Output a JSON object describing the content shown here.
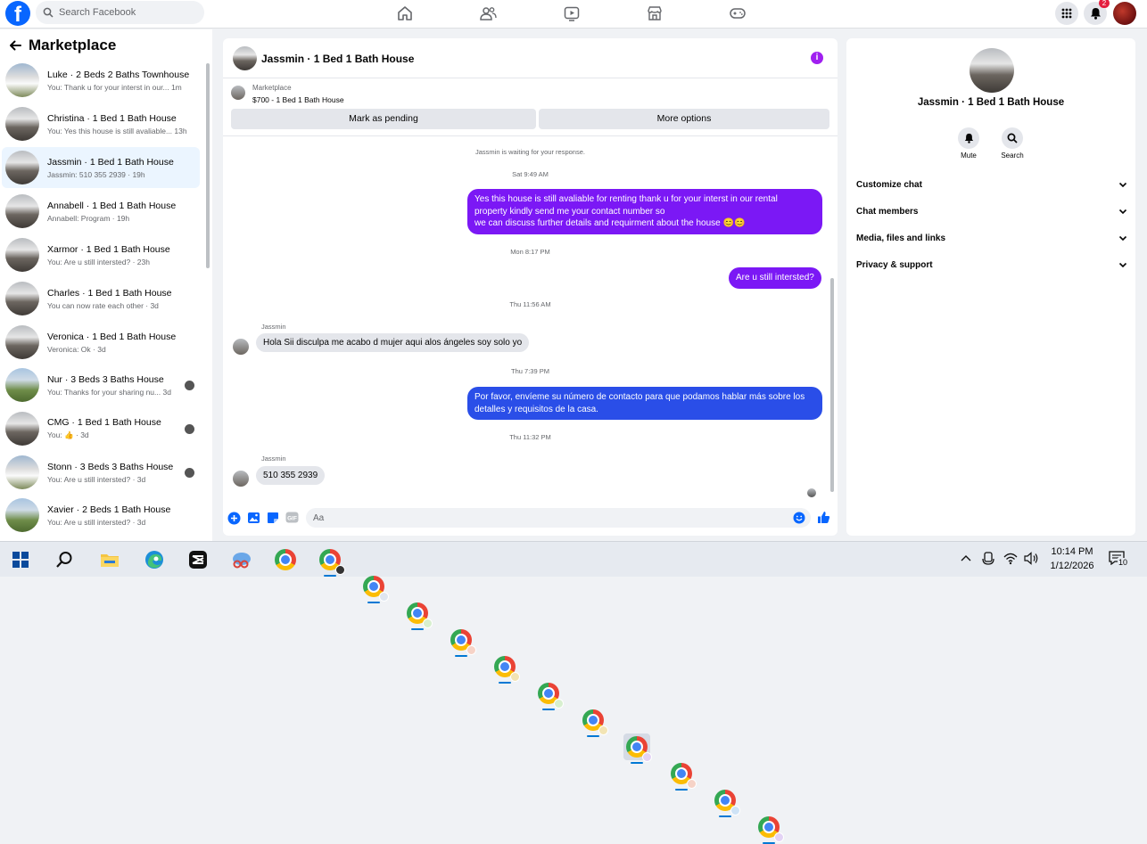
{
  "topbar": {
    "logo_letter": "f",
    "search_placeholder": "Search Facebook",
    "notification_count": "2"
  },
  "sidebar": {
    "title": "Marketplace",
    "conversations": [
      {
        "name": "Luke · 2 Beds 2 Baths Townhouse",
        "preview": "You: Thank u for your interst in our...",
        "time": "1m"
      },
      {
        "name": "Christina · 1 Bed 1 Bath House",
        "preview": "You: Yes this house is still avaliable...",
        "time": "13h"
      },
      {
        "name": "Jassmin · 1 Bed 1 Bath House",
        "preview": "Jassmin: 510 355 2939 · 19h",
        "time": ""
      },
      {
        "name": "Annabell · 1 Bed 1 Bath House",
        "preview": "Annabell: Program · 19h",
        "time": ""
      },
      {
        "name": "Xarmor · 1 Bed 1 Bath House",
        "preview": "You: Are u still intersted? · 23h",
        "time": ""
      },
      {
        "name": "Charles · 1 Bed 1 Bath House",
        "preview": "You can now rate each other · 3d",
        "time": ""
      },
      {
        "name": "Veronica · 1 Bed 1 Bath House",
        "preview": "Veronica: Ok · 3d",
        "time": ""
      },
      {
        "name": "Nur · 3 Beds 3 Baths House",
        "preview": "You: Thanks for your sharing nu...",
        "time": "3d"
      },
      {
        "name": "CMG · 1 Bed 1 Bath House",
        "preview": "You: 👍 · 3d",
        "time": ""
      },
      {
        "name": "Stonn · 3 Beds 3 Baths House",
        "preview": "You: Are u still intersted? · 3d",
        "time": ""
      },
      {
        "name": "Xavier · 2 Beds 1 Bath House",
        "preview": "You: Are u still intersted? · 3d",
        "time": ""
      }
    ]
  },
  "chat": {
    "title": "Jassmin · 1 Bed 1 Bath House",
    "marketplace_label": "Marketplace",
    "listing": "$700 - 1 Bed 1 Bath House",
    "mark_pending": "Mark as pending",
    "more_options": "More options",
    "waiting_notice": "Jassmin is waiting for your response.",
    "ts1": "Sat 9:49 AM",
    "msg1_line1": "Yes this house is still avaliable for renting thank u for your interst in our rental",
    "msg1_line2": "property kindly send me your contact number so",
    "msg1_line3": "we can discuss further details and requirment about the house 😊😊",
    "ts2": "Mon 8:17 PM",
    "msg2": "Are u still intersted?",
    "ts3": "Thu 11:56 AM",
    "sender1": "Jassmin",
    "msg3": "Hola Sii disculpa me acabo d mujer aqui alos ángeles soy solo yo",
    "ts4": "Thu 7:39 PM",
    "msg4_line1": "Por favor, envíeme su número de contacto para que podamos hablar más sobre los",
    "msg4_line2": "detalles y requisitos de la casa.",
    "ts5": "Thu 11:32 PM",
    "sender2": "Jassmin",
    "msg5": "510 355 2939",
    "input_placeholder": "Aa"
  },
  "info_panel": {
    "title": "Jassmin · 1 Bed 1 Bath House",
    "mute_label": "Mute",
    "search_label": "Search",
    "sections": [
      "Customize chat",
      "Chat members",
      "Media, files and links",
      "Privacy & support"
    ]
  },
  "taskbar": {
    "time": "10:14 PM",
    "date": "1/12/2026",
    "notif_count": "10"
  },
  "colors": {
    "facebook_blue": "#0866ff",
    "outgoing_purple": "#7b18f5",
    "outgoing_blue": "#2a4ee8",
    "badge_red": "#e41e3f"
  }
}
